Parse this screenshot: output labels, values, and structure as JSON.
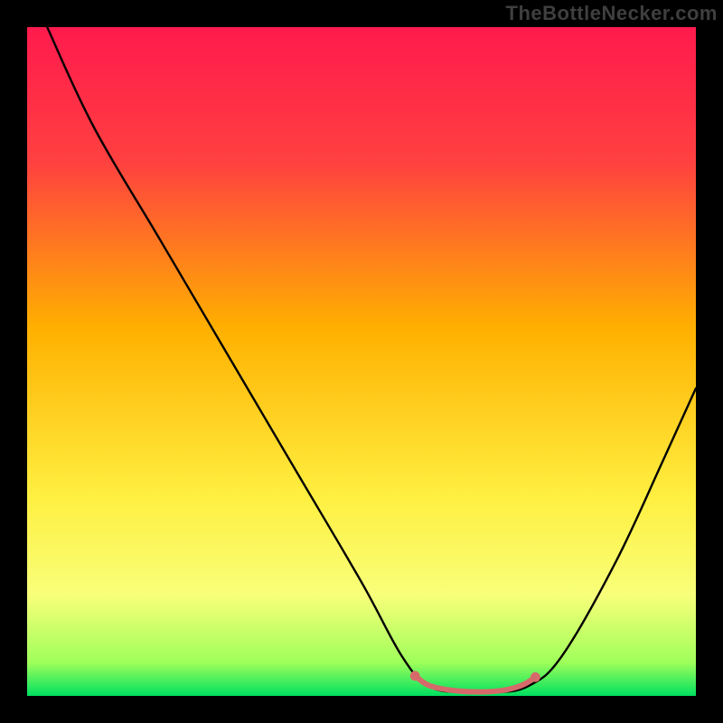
{
  "watermark": "TheBottleNecker.com",
  "chart_data": {
    "type": "line",
    "title": "",
    "xlabel": "",
    "ylabel": "",
    "xlim": [
      0,
      100
    ],
    "ylim": [
      0,
      100
    ],
    "gradient_stops": [
      {
        "offset": 0,
        "color": "#ff1a4d"
      },
      {
        "offset": 20,
        "color": "#ff4040"
      },
      {
        "offset": 45,
        "color": "#ffb000"
      },
      {
        "offset": 70,
        "color": "#ffef40"
      },
      {
        "offset": 85,
        "color": "#f8ff7a"
      },
      {
        "offset": 95,
        "color": "#9fff5a"
      },
      {
        "offset": 100,
        "color": "#00e060"
      }
    ],
    "series": [
      {
        "name": "bottleneck-curve",
        "color": "#000000",
        "width": 2.4,
        "points": [
          {
            "x": 3,
            "y": 100
          },
          {
            "x": 10,
            "y": 85
          },
          {
            "x": 20,
            "y": 68
          },
          {
            "x": 30,
            "y": 51
          },
          {
            "x": 40,
            "y": 34
          },
          {
            "x": 50,
            "y": 17
          },
          {
            "x": 56,
            "y": 6
          },
          {
            "x": 60,
            "y": 1.5
          },
          {
            "x": 65,
            "y": 0.5
          },
          {
            "x": 70,
            "y": 0.5
          },
          {
            "x": 75,
            "y": 1.5
          },
          {
            "x": 80,
            "y": 6
          },
          {
            "x": 88,
            "y": 20
          },
          {
            "x": 95,
            "y": 35
          },
          {
            "x": 100,
            "y": 46
          }
        ]
      },
      {
        "name": "sweet-spot",
        "color": "#d66a6a",
        "width": 6,
        "points": [
          {
            "x": 58,
            "y": 3.0
          },
          {
            "x": 60,
            "y": 1.6
          },
          {
            "x": 63,
            "y": 0.9
          },
          {
            "x": 67,
            "y": 0.6
          },
          {
            "x": 71,
            "y": 0.8
          },
          {
            "x": 74,
            "y": 1.6
          },
          {
            "x": 76,
            "y": 2.8
          }
        ],
        "end_dots": true
      }
    ]
  }
}
